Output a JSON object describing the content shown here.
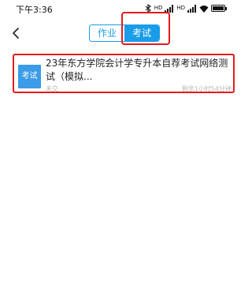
{
  "status_bar": {
    "time": "下午3:36",
    "signal_label": "HD",
    "icons": [
      "bluetooth-icon",
      "signal-icon",
      "signal-icon",
      "wifi-icon",
      "battery-icon"
    ]
  },
  "nav": {
    "back_icon": "chevron-left-icon"
  },
  "tabs": [
    {
      "label": "作业",
      "active": false
    },
    {
      "label": "考试",
      "active": true
    }
  ],
  "exam_list": [
    {
      "badge": "考试",
      "title": "23年东方学院会计学专升本自荐考试网络测试（模拟...",
      "status": "未交",
      "remaining": "剩余1小时54分钟"
    }
  ],
  "colors": {
    "accent": "#1a9de8",
    "badge": "#3b9ce8",
    "highlight": "#e5191f",
    "muted": "#b8b8b8"
  }
}
